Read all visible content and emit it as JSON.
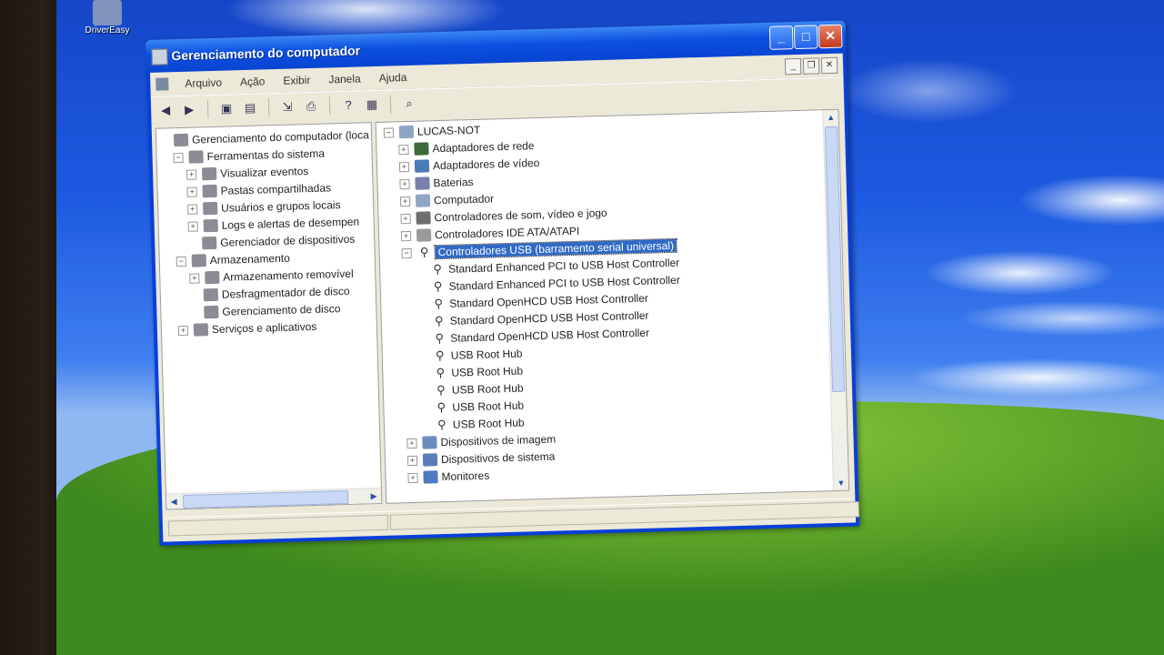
{
  "desktop": {
    "icon_label": "DriverEasy"
  },
  "window": {
    "title": "Gerenciamento do computador",
    "controls": {
      "minimize": "_",
      "maximize": "□",
      "close": "✕"
    },
    "mdi_controls": {
      "minimize": "_",
      "restore": "❐",
      "close": "✕"
    }
  },
  "menu": [
    "Arquivo",
    "Ação",
    "Exibir",
    "Janela",
    "Ajuda"
  ],
  "left_tree": [
    {
      "label": "Gerenciamento do computador (loca",
      "level": 0,
      "expander": ""
    },
    {
      "label": "Ferramentas do sistema",
      "level": 1,
      "expander": "−"
    },
    {
      "label": "Visualizar eventos",
      "level": 2,
      "expander": "+"
    },
    {
      "label": "Pastas compartilhadas",
      "level": 2,
      "expander": "+"
    },
    {
      "label": "Usuários e grupos locais",
      "level": 2,
      "expander": "+"
    },
    {
      "label": "Logs e alertas de desempen",
      "level": 2,
      "expander": "+"
    },
    {
      "label": "Gerenciador de dispositivos",
      "level": 2,
      "expander": ""
    },
    {
      "label": "Armazenamento",
      "level": 1,
      "expander": "−"
    },
    {
      "label": "Armazenamento removível",
      "level": 2,
      "expander": "+"
    },
    {
      "label": "Desfragmentador de disco",
      "level": 2,
      "expander": ""
    },
    {
      "label": "Gerenciamento de disco",
      "level": 2,
      "expander": ""
    },
    {
      "label": "Serviços e aplicativos",
      "level": 1,
      "expander": "+"
    }
  ],
  "right_tree": [
    {
      "label": "LUCAS-NOT",
      "level": 0,
      "expander": "−",
      "icon": "computer-icon"
    },
    {
      "label": "Adaptadores de rede",
      "level": 1,
      "expander": "+",
      "icon": "network-adapter-icon"
    },
    {
      "label": "Adaptadores de vídeo",
      "level": 1,
      "expander": "+",
      "icon": "display-adapter-icon"
    },
    {
      "label": "Baterias",
      "level": 1,
      "expander": "+",
      "icon": "battery-icon"
    },
    {
      "label": "Computador",
      "level": 1,
      "expander": "+",
      "icon": "computer-icon"
    },
    {
      "label": "Controladores de som, vídeo e jogo",
      "level": 1,
      "expander": "+",
      "icon": "sound-icon"
    },
    {
      "label": "Controladores IDE ATA/ATAPI",
      "level": 1,
      "expander": "+",
      "icon": "ide-icon"
    },
    {
      "label": "Controladores USB (barramento serial universal)",
      "level": 1,
      "expander": "−",
      "icon": "usb-icon",
      "selected": true
    },
    {
      "label": "Standard Enhanced PCI to USB Host Controller",
      "level": 2,
      "expander": "",
      "icon": "usb-icon"
    },
    {
      "label": "Standard Enhanced PCI to USB Host Controller",
      "level": 2,
      "expander": "",
      "icon": "usb-icon"
    },
    {
      "label": "Standard OpenHCD USB Host Controller",
      "level": 2,
      "expander": "",
      "icon": "usb-icon"
    },
    {
      "label": "Standard OpenHCD USB Host Controller",
      "level": 2,
      "expander": "",
      "icon": "usb-icon"
    },
    {
      "label": "Standard OpenHCD USB Host Controller",
      "level": 2,
      "expander": "",
      "icon": "usb-icon"
    },
    {
      "label": "USB Root Hub",
      "level": 2,
      "expander": "",
      "icon": "usb-icon"
    },
    {
      "label": "USB Root Hub",
      "level": 2,
      "expander": "",
      "icon": "usb-icon"
    },
    {
      "label": "USB Root Hub",
      "level": 2,
      "expander": "",
      "icon": "usb-icon"
    },
    {
      "label": "USB Root Hub",
      "level": 2,
      "expander": "",
      "icon": "usb-icon"
    },
    {
      "label": "USB Root Hub",
      "level": 2,
      "expander": "",
      "icon": "usb-icon"
    },
    {
      "label": "Dispositivos de imagem",
      "level": 1,
      "expander": "+",
      "icon": "camera-icon"
    },
    {
      "label": "Dispositivos de sistema",
      "level": 1,
      "expander": "+",
      "icon": "system-device-icon"
    },
    {
      "label": "Monitores",
      "level": 1,
      "expander": "+",
      "icon": "monitor-icon"
    }
  ],
  "colors": {
    "titlebar": "#0a50e0",
    "selection": "#316ac5",
    "chrome": "#ece9d8",
    "close_button": "#c4371a"
  }
}
